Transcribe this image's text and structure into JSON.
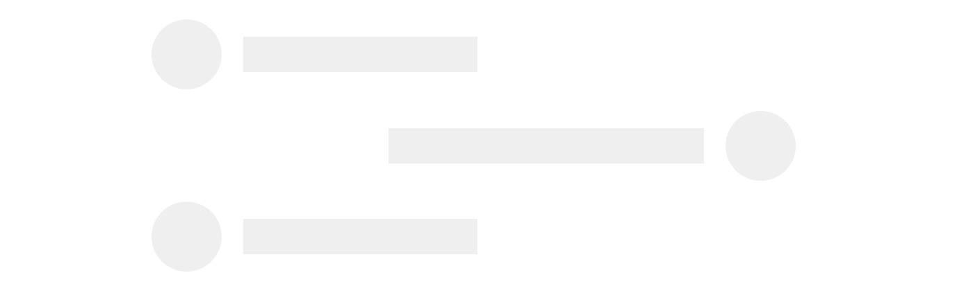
{
  "colors": {
    "background": "#ffffff",
    "placeholder": "#efefef"
  },
  "messages": [
    {
      "side": "left",
      "text": ""
    },
    {
      "side": "right",
      "text": ""
    },
    {
      "side": "left",
      "text": ""
    }
  ]
}
